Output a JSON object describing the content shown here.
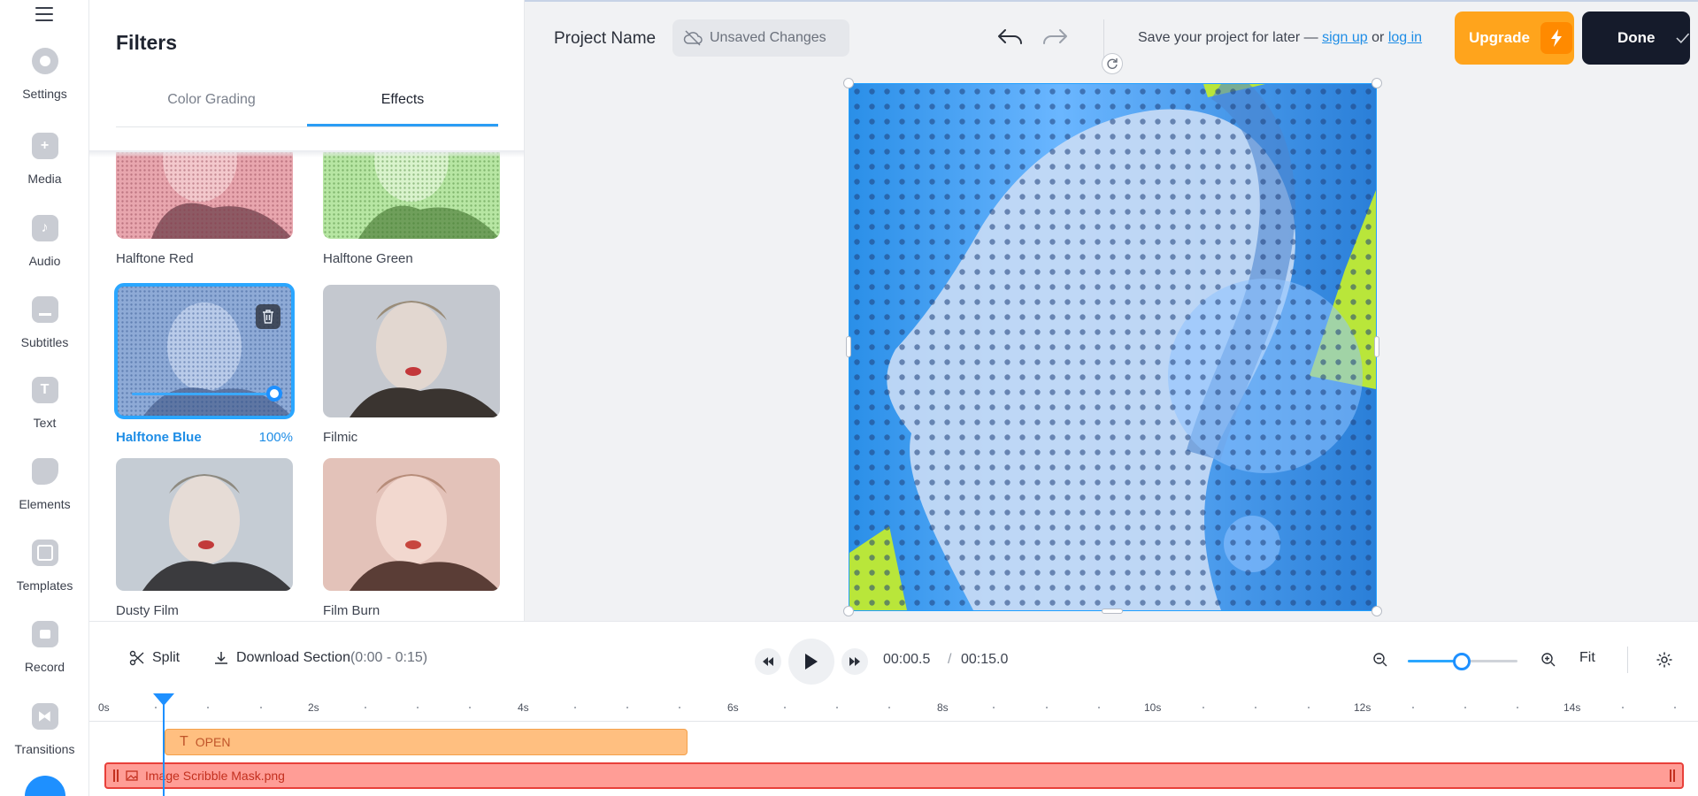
{
  "rail": {
    "items": [
      {
        "label": "Settings",
        "icon": "settings-icon"
      },
      {
        "label": "Media",
        "icon": "plus-icon"
      },
      {
        "label": "Audio",
        "icon": "music-icon"
      },
      {
        "label": "Subtitles",
        "icon": "subtitles-icon"
      },
      {
        "label": "Text",
        "icon": "text-icon"
      },
      {
        "label": "Elements",
        "icon": "elements-icon"
      },
      {
        "label": "Templates",
        "icon": "templates-icon"
      },
      {
        "label": "Record",
        "icon": "record-icon"
      },
      {
        "label": "Transitions",
        "icon": "transitions-icon"
      }
    ]
  },
  "filters": {
    "title": "Filters",
    "tabs": [
      {
        "label": "Color Grading",
        "active": false
      },
      {
        "label": "Effects",
        "active": true
      }
    ],
    "cards": [
      {
        "label": "Halftone Red",
        "tint": "#e8a6ae"
      },
      {
        "label": "Halftone Green",
        "tint": "#b7e6a3"
      },
      {
        "label": "Halftone Blue",
        "tint": "#8eaad6",
        "selected": true,
        "value": "100%",
        "intensity": 1.0
      },
      {
        "label": "Filmic",
        "tint": "#c4c8cf"
      },
      {
        "label": "Dusty Film",
        "tint": "#c5ccd4"
      },
      {
        "label": "Film Burn",
        "tint": "#e3c2b9"
      }
    ]
  },
  "topbar": {
    "project_name": "Project Name",
    "unsaved": "Unsaved Changes",
    "save_prefix": "Save your project for later — ",
    "sign_up": "sign up",
    "or": " or ",
    "log_in": "log in",
    "upgrade": "Upgrade",
    "done": "Done"
  },
  "controls": {
    "split": "Split",
    "download": "Download Section",
    "download_range": "(0:00 - 0:15)",
    "current_time": "00:00.5",
    "separator": "/",
    "total_time": "00:15.0",
    "fit": "Fit",
    "zoom_level": 0.5
  },
  "timeline": {
    "ticks": [
      "0s",
      "2s",
      "4s",
      "6s",
      "8s",
      "10s",
      "12s",
      "14s"
    ],
    "text_clip": "OPEN",
    "image_clip": "Image Scribble Mask.png"
  },
  "colors": {
    "accent": "#1e90ff",
    "upgrade": "#ffa41c",
    "done": "#151b2b",
    "text_clip": "#ffbf80",
    "image_clip": "#ff9d96"
  }
}
